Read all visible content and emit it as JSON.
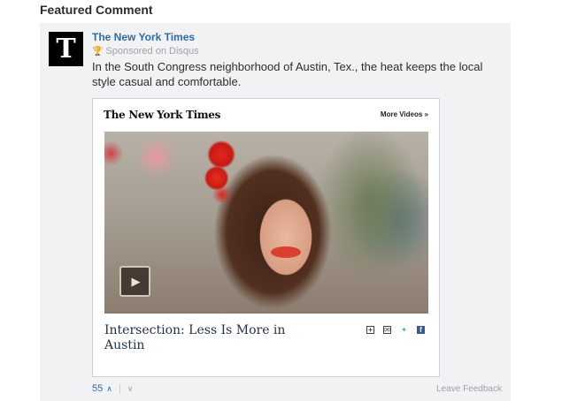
{
  "section_title": "Featured Comment",
  "comment": {
    "avatar_glyph": "T",
    "author": "The New York Times",
    "sponsor_text": "Sponsored on Disqus",
    "message": "In the South Congress neighborhood of Austin, Tex., the heat keeps the local style casual and comfortable."
  },
  "embed": {
    "logo": "The New York Times",
    "more_videos": "More Videos »",
    "video_title": "Intersection: Less Is More in Austin",
    "play_glyph": "▶",
    "share_icons": [
      "plus-icon",
      "email-icon",
      "twitter-icon",
      "facebook-icon"
    ]
  },
  "votes": {
    "count": "55",
    "up_glyph": "∧",
    "down_glyph": "∨"
  },
  "footer": {
    "leave_feedback": "Leave Feedback"
  },
  "colors": {
    "link_blue": "#2e6ba8",
    "card_bg": "#f1f2f3",
    "muted_gray": "#9ea3a7"
  }
}
